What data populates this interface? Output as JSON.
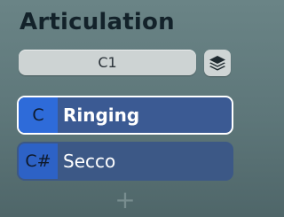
{
  "panel": {
    "title": "Articulation"
  },
  "keyswitch": {
    "value": "C1"
  },
  "layers_button": {
    "icon": "layers-icon"
  },
  "articulations": [
    {
      "key": "C",
      "name": "Ringing",
      "selected": true
    },
    {
      "key": "C#",
      "name": "Secco",
      "selected": false
    }
  ],
  "add_button": {
    "label": "+"
  },
  "colors": {
    "background": "#5f787b",
    "title": "#13222a",
    "selected_border": "#ffffff",
    "item_body": "#3c5886",
    "item_key": "#2e6bd9"
  }
}
